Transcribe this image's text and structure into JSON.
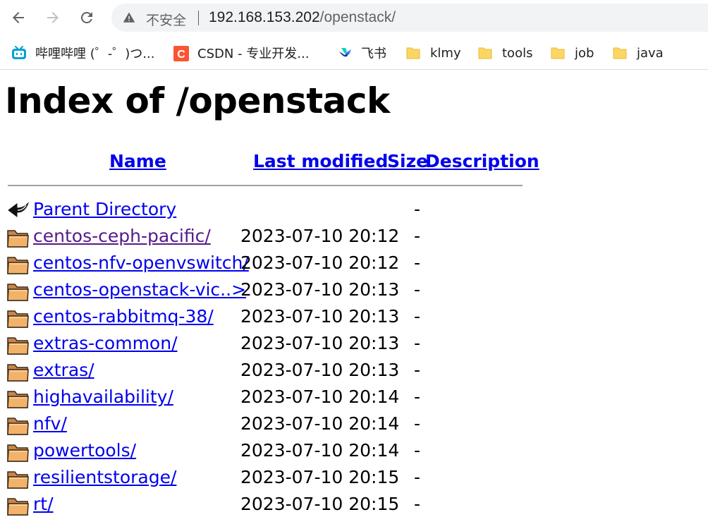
{
  "browser": {
    "security_label": "不安全",
    "url_host": "192.168.153.202",
    "url_path": "/openstack/",
    "bookmarks": [
      {
        "label": "哔哩哔哩 (゜-゜)つ...",
        "icon": "bilibili-icon"
      },
      {
        "label": "CSDN - 专业开发...",
        "icon": "csdn-icon"
      },
      {
        "label": "飞书",
        "icon": "feishu-icon"
      },
      {
        "label": "klmy",
        "icon": "folder-icon"
      },
      {
        "label": "tools",
        "icon": "folder-icon"
      },
      {
        "label": "job",
        "icon": "folder-icon"
      },
      {
        "label": "java",
        "icon": "folder-icon"
      }
    ]
  },
  "page": {
    "title": "Index of /openstack",
    "columns": {
      "name": "Name",
      "last_modified": "Last modified",
      "size": "Size",
      "description": "Description"
    },
    "rows": [
      {
        "name": "Parent Directory",
        "date": "",
        "size": "-",
        "icon": "back-icon",
        "visited": false
      },
      {
        "name": "centos-ceph-pacific/",
        "date": "2023-07-10 20:12",
        "size": "-",
        "icon": "folder-icon",
        "visited": true
      },
      {
        "name": "centos-nfv-openvswitch/",
        "date": "2023-07-10 20:12",
        "size": "-",
        "icon": "folder-icon",
        "visited": false
      },
      {
        "name": "centos-openstack-vic..>",
        "date": "2023-07-10 20:13",
        "size": "-",
        "icon": "folder-icon",
        "visited": false
      },
      {
        "name": "centos-rabbitmq-38/",
        "date": "2023-07-10 20:13",
        "size": "-",
        "icon": "folder-icon",
        "visited": false
      },
      {
        "name": "extras-common/",
        "date": "2023-07-10 20:13",
        "size": "-",
        "icon": "folder-icon",
        "visited": false
      },
      {
        "name": "extras/",
        "date": "2023-07-10 20:13",
        "size": "-",
        "icon": "folder-icon",
        "visited": false
      },
      {
        "name": "highavailability/",
        "date": "2023-07-10 20:14",
        "size": "-",
        "icon": "folder-icon",
        "visited": false
      },
      {
        "name": "nfv/",
        "date": "2023-07-10 20:14",
        "size": "-",
        "icon": "folder-icon",
        "visited": false
      },
      {
        "name": "powertools/",
        "date": "2023-07-10 20:14",
        "size": "-",
        "icon": "folder-icon",
        "visited": false
      },
      {
        "name": "resilientstorage/",
        "date": "2023-07-10 20:15",
        "size": "-",
        "icon": "folder-icon",
        "visited": false
      },
      {
        "name": "rt/",
        "date": "2023-07-10 20:15",
        "size": "-",
        "icon": "folder-icon",
        "visited": false
      }
    ]
  },
  "colors": {
    "link": "#0000ee",
    "visited_link": "#551a8b",
    "omnibox_bg": "#f1f3f4"
  }
}
